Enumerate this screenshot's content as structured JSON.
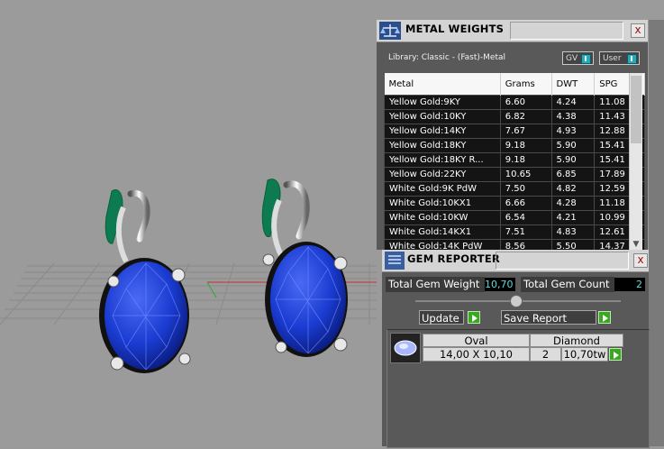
{
  "metal_weights": {
    "title": "METAL WEIGHTS",
    "close": "x",
    "library": "Library: Classic - (Fast)-Metal",
    "toggles": [
      "GV",
      "User"
    ],
    "columns": [
      "Metal",
      "Grams",
      "DWT",
      "SPG"
    ],
    "rows": [
      [
        "Yellow Gold:9KY",
        "6.60",
        "4.24",
        "11.08"
      ],
      [
        "Yellow Gold:10KY",
        "6.82",
        "4.38",
        "11.43"
      ],
      [
        "Yellow Gold:14KY",
        "7.67",
        "4.93",
        "12.88"
      ],
      [
        "Yellow Gold:18KY",
        "9.18",
        "5.90",
        "15.41"
      ],
      [
        "Yellow Gold:18KY R...",
        "9.18",
        "5.90",
        "15.41"
      ],
      [
        "Yellow Gold:22KY",
        "10.65",
        "6.85",
        "17.89"
      ],
      [
        "White Gold:9K PdW",
        "7.50",
        "4.82",
        "12.59"
      ],
      [
        "White Gold:10KX1",
        "6.66",
        "4.28",
        "11.18"
      ],
      [
        "White Gold:10KW",
        "6.54",
        "4.21",
        "10.99"
      ],
      [
        "White Gold:14KX1",
        "7.51",
        "4.83",
        "12.61"
      ],
      [
        "White Gold:14K PdW",
        "8.56",
        "5.50",
        "14.37"
      ]
    ]
  },
  "gem_reporter": {
    "title": "GEM REPORTER",
    "close": "x",
    "total_weight_label": "Total Gem Weight",
    "total_weight_value": "10,70",
    "total_count_label": "Total Gem Count",
    "total_count_value": "2",
    "update_label": "Update",
    "save_label": "Save Report",
    "gem": {
      "shape": "Oval",
      "size": "14,00 X 10,10",
      "material": "Diamond",
      "count": "2",
      "weight": "10,70tw"
    }
  },
  "colors": {
    "gem_blue": "#1a3bd0",
    "prong_green": "#0e7a52",
    "accent_teal": "#29a8b8",
    "play_green": "#38a81e"
  }
}
